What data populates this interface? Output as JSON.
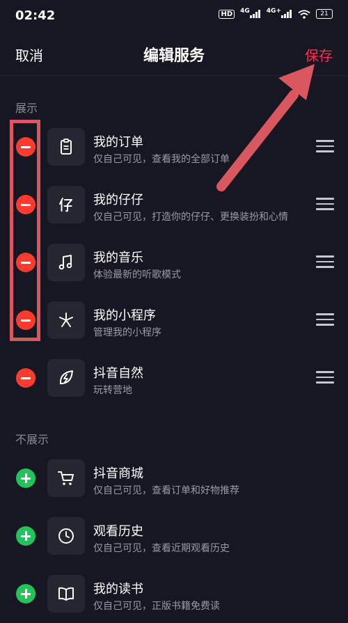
{
  "status_bar": {
    "time": "02:42",
    "hd": "HD",
    "net1": "4G",
    "net2": "4G+",
    "battery": "21"
  },
  "header": {
    "cancel": "取消",
    "title": "编辑服务",
    "save": "保存"
  },
  "sections": {
    "shown_label": "展示",
    "hidden_label": "不展示"
  },
  "shown_items": [
    {
      "title": "我的订单",
      "subtitle": "仅自己可见，查看我的全部订单",
      "icon": "clipboard-icon"
    },
    {
      "title": "我的仔仔",
      "subtitle": "仅自己可见，打造你的仔仔、更换装扮和心情",
      "icon": "zaizai-icon"
    },
    {
      "title": "我的音乐",
      "subtitle": "体验最新的听歌模式",
      "icon": "music-note-icon"
    },
    {
      "title": "我的小程序",
      "subtitle": "管理我的小程序",
      "icon": "mini-program-icon"
    },
    {
      "title": "抖音自然",
      "subtitle": "玩转营地",
      "icon": "nature-leaf-icon"
    }
  ],
  "hidden_items": [
    {
      "title": "抖音商城",
      "subtitle": "仅自己可见，查看订单和好物推荐",
      "icon": "shopping-cart-icon"
    },
    {
      "title": "观看历史",
      "subtitle": "仅自己可见，查看近期观看历史",
      "icon": "clock-icon"
    },
    {
      "title": "我的读书",
      "subtitle": "仅自己可见，正版书籍免费读",
      "icon": "book-icon"
    }
  ],
  "colors": {
    "accent": "#ff2d55",
    "remove": "#ff3b30",
    "add": "#23c25a",
    "annotation": "#d9585f"
  }
}
